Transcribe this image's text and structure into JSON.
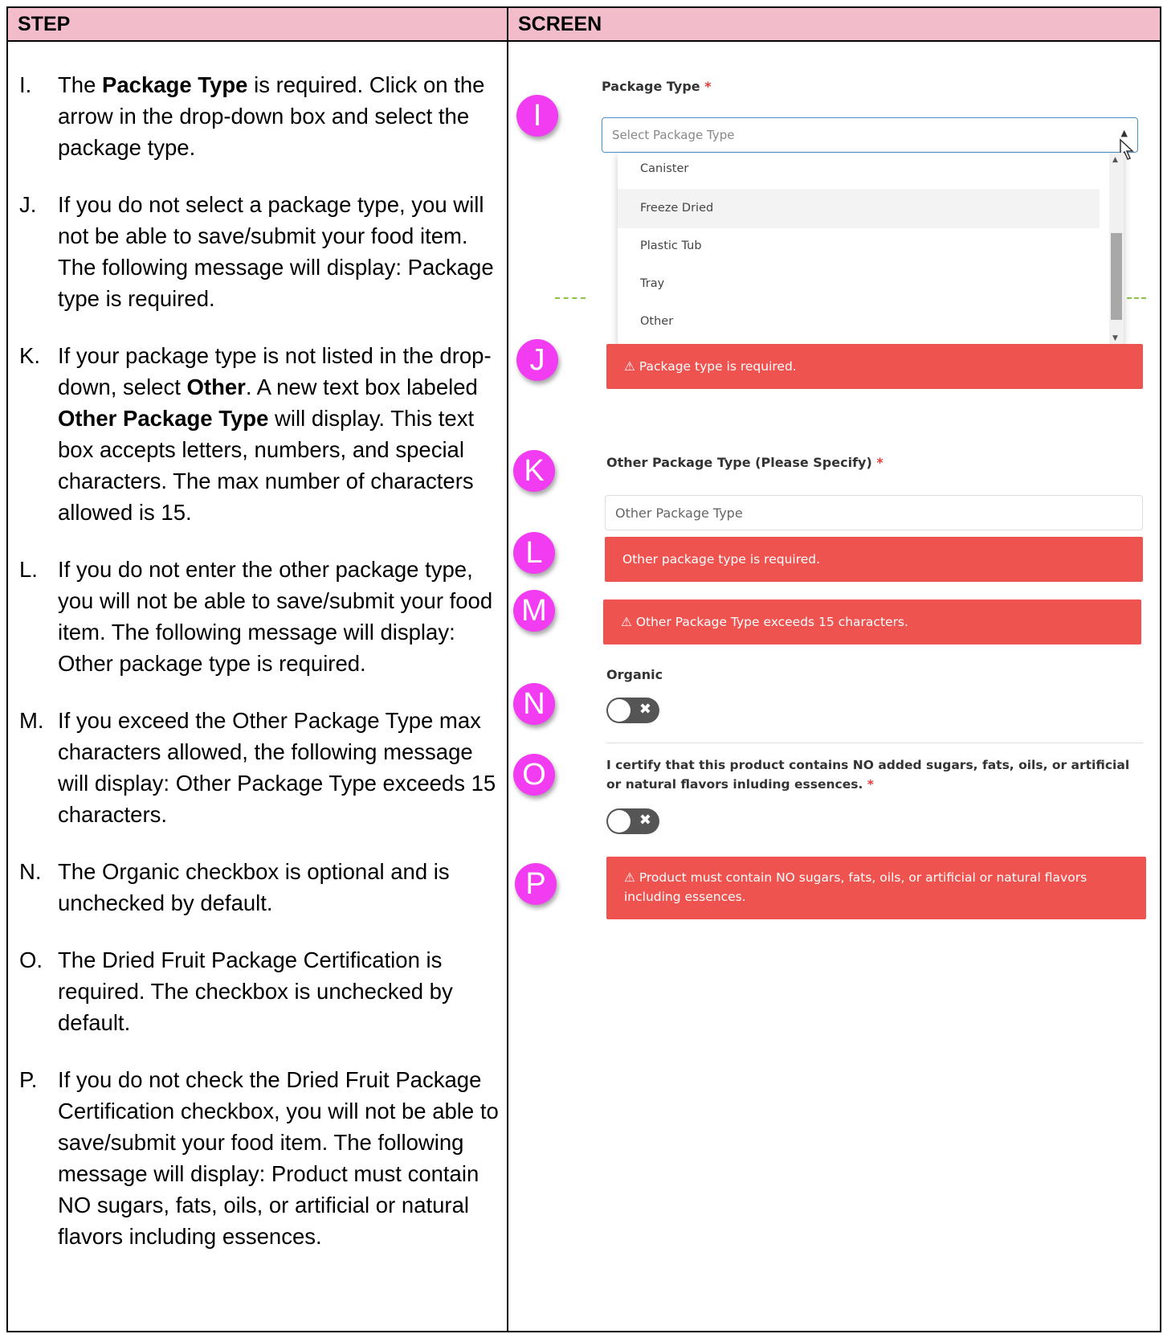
{
  "table": {
    "col_step": "STEP",
    "col_screen": "SCREEN"
  },
  "steps": [
    {
      "letter": "I.",
      "text": "The <b>Package Type</b> is required. Click on the arrow in the drop-down box and select the package type."
    },
    {
      "letter": "J.",
      "text": "If you do not select a package type, you will not be able to save/submit your food item.  The following message will display: Package type is required."
    },
    {
      "letter": "K.",
      "text": "If your package type is not listed in the drop-down, select <b>Other</b>.  A new text box labeled <b>Other Package Type</b> will display.  This text box accepts letters, numbers, and special characters.  The max number of characters allowed is 15."
    },
    {
      "letter": "L.",
      "text": "If you do not enter the other package type, you will not be able to save/submit your food item. The following message will display:  Other package type is required."
    },
    {
      "letter": "M.",
      "text": "If you exceed the Other Package Type max characters allowed, the following message will display:  Other Package Type exceeds 15 characters."
    },
    {
      "letter": "N.",
      "text": "The Organic checkbox is optional and is unchecked by default."
    },
    {
      "letter": "O.",
      "text": "The Dried Fruit Package Certification is required.  The checkbox is unchecked by default."
    },
    {
      "letter": "P.",
      "text": "If you do not check the Dried Fruit Package Certification checkbox, you will not be able to save/submit your food item.  The following message will display: Product must contain NO sugars, fats, oils, or artificial or natural flavors including essences."
    }
  ],
  "badges": {
    "i": "I",
    "j": "J",
    "k": "K",
    "l": "L",
    "m": "M",
    "n": "N",
    "o": "O",
    "p": "P"
  },
  "screen": {
    "package_type_label": "Package Type",
    "required_star": "*",
    "select_placeholder": "Select Package Type",
    "options": [
      "Canister",
      "Freeze Dried",
      "Plastic Tub",
      "Tray",
      "Other"
    ],
    "alert_package_required": "⚠ Package type is required.",
    "other_label": "Other Package Type (Please Specify)",
    "other_placeholder": "Other Package Type",
    "alert_other_required": "Other package type is required.",
    "alert_other_exceeds": "⚠ Other Package Type exceeds 15 characters.",
    "organic_label": "Organic",
    "cert_label": "I certify that this product contains NO added sugars, fats, oils, or artificial or natural flavors inluding essences.",
    "alert_cert": "⚠ Product must contain NO sugars, fats, oils, or artificial or natural flavors including essences."
  },
  "colors": {
    "header_bg": "#f2bccb",
    "badge": "#f23cf2",
    "alert": "#ef5350",
    "focus_border": "#4a90c8"
  }
}
